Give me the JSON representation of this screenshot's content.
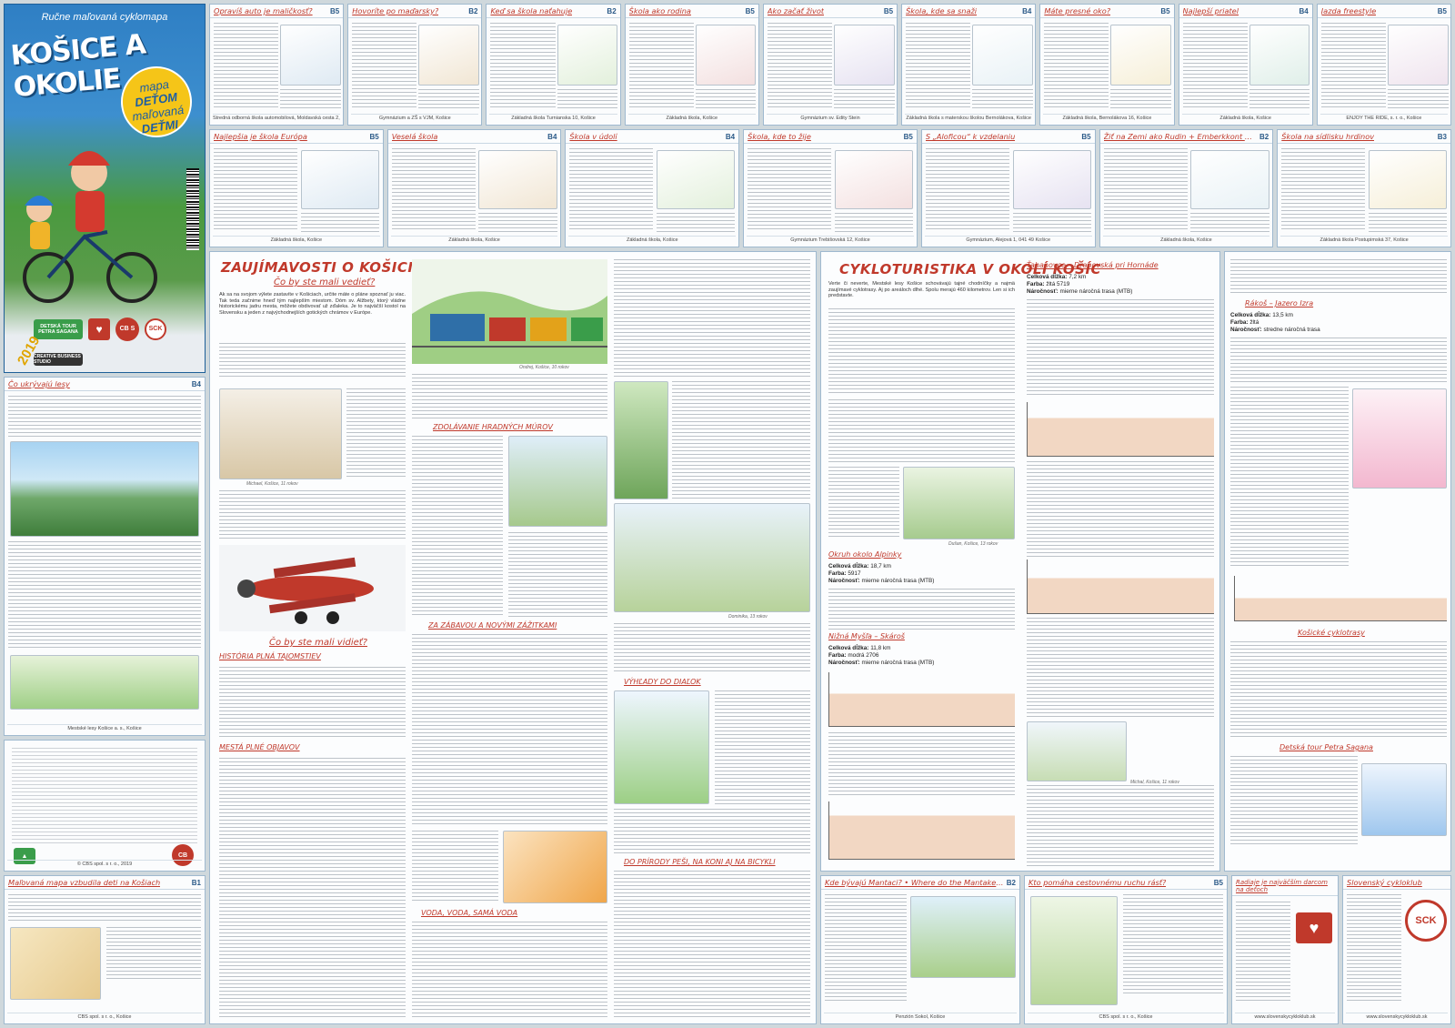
{
  "cover": {
    "subtitle": "Ručne maľovaná cyklomapa",
    "title": "KOŠICE A OKOLIE",
    "badge_line1": "mapa",
    "badge_line2": "DEŤOM",
    "badge_line3": "maľovaná",
    "badge_line4": "DEŤMI",
    "year": "2019",
    "logo_creative": "CREATIVE BUSINESS STUDIO",
    "logo_sck": "SCK",
    "logo_cbs": "CB S",
    "logo_tour": "DETSKÁ TOUR PETRA SAGANA"
  },
  "top_row": [
    {
      "title": "Opravíš auto je maličkosť?",
      "code": "B5",
      "footer": "Stredná odborná škola automobilová, Moldavská cesta 2, 042 99 Košice"
    },
    {
      "title": "Hovoríte po maďarsky?",
      "code": "B2",
      "footer": "Gymnázium a ZŠ s VJM, Košice"
    },
    {
      "title": "Keď sa škola naťahuje",
      "code": "B2",
      "footer": "Základná škola Turnianska 10, Košice"
    },
    {
      "title": "Škola ako rodina",
      "code": "B5",
      "footer": "Základná škola, Košice"
    },
    {
      "title": "Ako začať život",
      "code": "B5",
      "footer": "Gymnázium sv. Edity Stein"
    },
    {
      "title": "Škola, kde sa snaží",
      "code": "B4",
      "footer": "Základná škola s materskou školou Bernolákova, Košice"
    },
    {
      "title": "Máte presné oko?",
      "code": "B5",
      "footer": "Základná škola, Bernolákova 16, Košice"
    },
    {
      "title": "Najlepší priateľ",
      "code": "B4",
      "footer": "Základná škola, Košice"
    },
    {
      "title": "Jazda freestyle",
      "code": "B5",
      "footer": "ENJOY THE RIDE, s. r. o., Košice"
    }
  ],
  "second_row": [
    {
      "title": "Najlepšia je škola Európa",
      "code": "B5",
      "footer": "Základná škola, Košice"
    },
    {
      "title": "Veselá škola",
      "code": "B4",
      "footer": "Základná škola, Košice"
    },
    {
      "title": "Škola v údolí",
      "code": "B4",
      "footer": "Základná škola, Košice"
    },
    {
      "title": "Škola, kde to žije",
      "code": "B5",
      "footer": "Gymnázium Trebišovská 12, Košice"
    },
    {
      "title": "S „Aloficou“ k vzdelaniu",
      "code": "B5",
      "footer": "Gymnázium, Alejová 1, 041 49 Košice"
    },
    {
      "title": "Žiť na Zemi ako Rudin + Emberkkont dní s Fölldom",
      "code": "B2",
      "footer": "Základná škola, Košice"
    },
    {
      "title": "Škola na sídlisku hrdinov",
      "code": "B3",
      "footer": "Základná škola Postupimská 37, Košice"
    }
  ],
  "left_column": [
    {
      "title": "Čo ukrývajú lesy",
      "code": "B4",
      "footer": "Mestské lesy Košice a. s., Košice"
    },
    {
      "title": "",
      "code": "",
      "footer": "© CBS spol. s r. o., 2019"
    },
    {
      "title": "Maľovaná mapa vzbudila deti na Košiach",
      "code": "B1",
      "footer": "CBS spol. s r. o., Košice"
    }
  ],
  "main_left": {
    "title": "ZAUJÍMAVOSTI O KOŠICIACH A OKOLÍ",
    "sub1": "Čo by ste mali vedieť?",
    "sub2": "Čo by ste mali vidieť?",
    "sub3": "HISTÓRIA PLNÁ TAJOMSTIEV",
    "sub4": "MESTÁ PLNÉ OBJAVOV",
    "sub5": "ZDOLÁVANIE HRADNÝCH MÚROV",
    "sub6": "ZA ZÁBAVOU A NOVÝMI ZÁŽITKAMI",
    "sub7": "VODA, VODA, SAMÁ VODA",
    "sub8": "VÝHĽADY DO DIAĽOK",
    "sub9": "DO PRÍRODY PEŠI, NA KONI AJ NA BICYKLI",
    "caption1": "Michael, Košice, 11 rokov",
    "caption2": "Ondrej, Košice, 10 rokov",
    "caption3": "Dominika, 13 rokov",
    "intro": "Ak sa na svojom výlete zastavíte v Košiciach, určite máte o pláne spoznať ju viac. Tak teda začnime hneď tým najlepším miestom. Dóm sv. Alžbety, ktorý vládne historickému jadru mesta, môžete obdivovať už zďaleka. Je to najväčší kostol na Slovensku a jeden z najvýchodnejších gotických chrámov v Európe."
  },
  "main_right": {
    "title": "CYKLOTURISTIKA V OKOLÍ KOŠÍC",
    "route1": "Ťahanovce – Drahovská pri Hornáde",
    "route1_length": "7,2 km",
    "route1_color": "žltá 5719",
    "route1_difficulty": "mierne náročná trasa (MTB)",
    "route2": "Okruh okolo Alpinky",
    "route2_length": "18,7 km",
    "route2_color": "5917",
    "route2_difficulty": "mierne náročná trasa (MTB)",
    "route3": "Nižná Myšľa – Skároš",
    "route3_length": "11,8 km",
    "route3_color": "modrá 2706",
    "route3_difficulty": "mierne náročná trasa (MTB)",
    "route4": "Rákoš – Jazero Izra",
    "route4_length": "13,5 km",
    "route4_color": "žltá",
    "route4_difficulty": "stredne náročná trasa",
    "route5": "Košické cyklotrasy",
    "route6": "Detská tour Petra Sagana",
    "label_length": "Celková dĺžka:",
    "label_color": "Farba:",
    "label_difficulty": "Náročnosť:",
    "intro": "Verte či neverte, Mestské lesy Košice schovávajú tajné chodníčky a najmä zaujímavé cyklotrasy. Aj po areáloch dlhé. Spolu merajú 460 kilometrov. Len si ich predstavte.",
    "caption1": "Dušan, Košice, 13 rokov",
    "caption2": "Michal, Košice, 11 rokov"
  },
  "bottom_row": [
    {
      "title": "Kde bývajú Mantaci? • Where do the Mantaken live?",
      "code": "B2",
      "footer": "Penzión Sokol, Košice"
    },
    {
      "title": "Kto pomáha cestovnému ruchu rásť?",
      "code": "B5",
      "footer": "CBS spol. s r. o., Košice"
    },
    {
      "title": "Radiaje je najväčším darcom na deťoch",
      "code": "",
      "footer": "www.slovenskycykloklub.sk"
    },
    {
      "title": "Slovenský cykloklub",
      "code": "",
      "footer": "www.slovenskycykloklub.sk"
    }
  ]
}
